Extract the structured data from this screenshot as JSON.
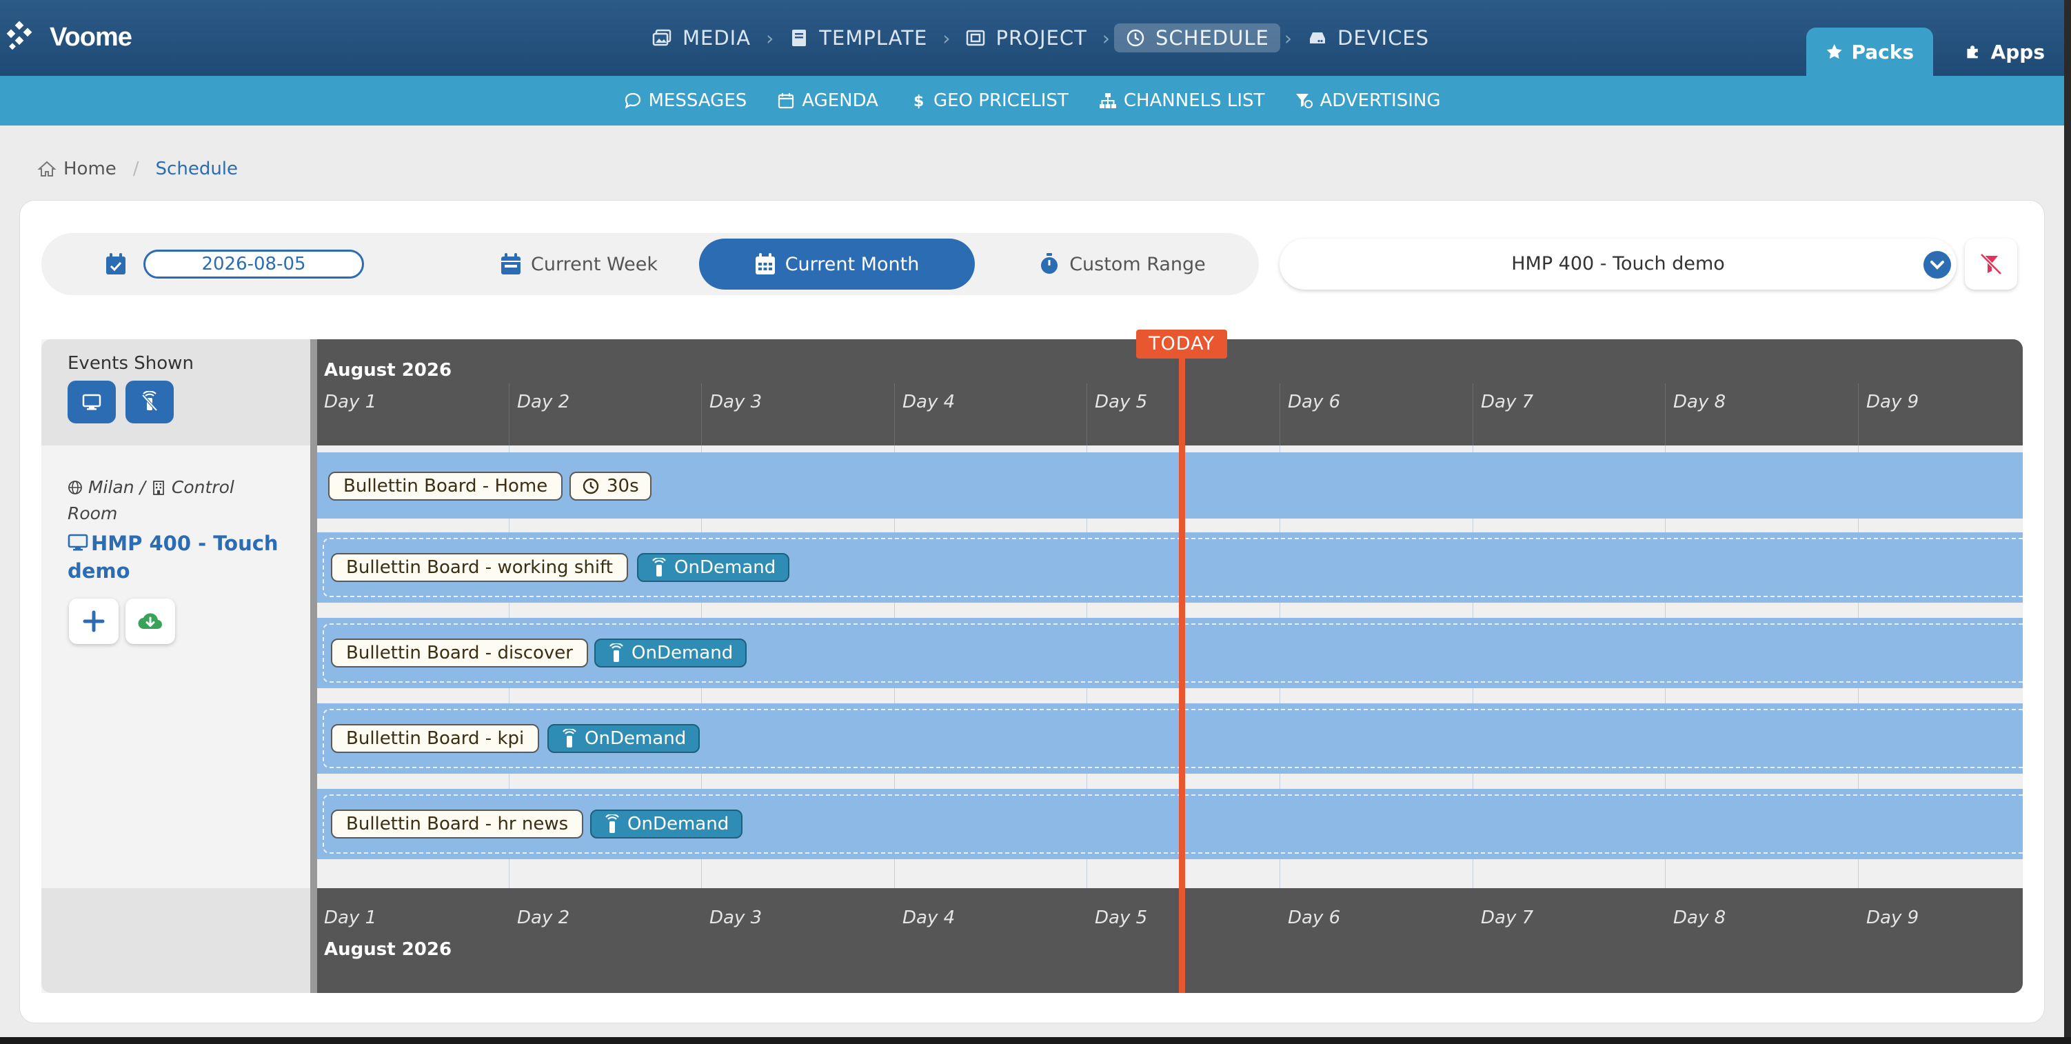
{
  "app": {
    "logo_text": "Voome"
  },
  "nav": {
    "steps": [
      {
        "label": "MEDIA",
        "icon": "images-icon"
      },
      {
        "label": "TEMPLATE",
        "icon": "book-icon"
      },
      {
        "label": "PROJECT",
        "icon": "project-icon"
      },
      {
        "label": "SCHEDULE",
        "icon": "clock-icon",
        "active": true
      },
      {
        "label": "DEVICES",
        "icon": "hdd-icon"
      }
    ],
    "packs_label": "Packs",
    "apps_label": "Apps"
  },
  "subnav": {
    "items": [
      {
        "label": "MESSAGES",
        "icon": "comment-icon"
      },
      {
        "label": "AGENDA",
        "icon": "calendar-icon"
      },
      {
        "label": "GEO PRICELIST",
        "icon": "dollar-icon"
      },
      {
        "label": "CHANNELS LIST",
        "icon": "sitemap-icon"
      },
      {
        "label": "ADVERTISING",
        "icon": "ad-filter-icon"
      }
    ]
  },
  "breadcrumb": {
    "home": "Home",
    "current": "Schedule"
  },
  "controls": {
    "date_value": "2026-08-05",
    "current_week": "Current Week",
    "current_month": "Current Month",
    "custom_range": "Custom Range",
    "device_selected": "HMP 400 - Touch demo"
  },
  "timeline": {
    "events_shown_label": "Events Shown",
    "month_label": "August 2026",
    "days": [
      "Day 1",
      "Day 2",
      "Day 3",
      "Day 4",
      "Day 5",
      "Day 6",
      "Day 7",
      "Day 8",
      "Day 9"
    ],
    "today_label": "TODAY",
    "location": {
      "city": "Milan",
      "separator": "/",
      "room": "Control Room"
    },
    "device_name": "HMP 400 - Touch demo",
    "events": [
      {
        "name": "Bullettin Board - Home",
        "tag": "30s",
        "tag_type": "duration"
      },
      {
        "name": "Bullettin Board - working shift",
        "tag": "OnDemand",
        "tag_type": "ondemand"
      },
      {
        "name": "Bullettin Board - discover",
        "tag": "OnDemand",
        "tag_type": "ondemand"
      },
      {
        "name": "Bullettin Board - kpi",
        "tag": "OnDemand",
        "tag_type": "ondemand"
      },
      {
        "name": "Bullettin Board - hr news",
        "tag": "OnDemand",
        "tag_type": "ondemand"
      }
    ]
  },
  "colors": {
    "nav_dark": "#1f4a76",
    "nav_light": "#3a9fc9",
    "accent_blue": "#2b6cb3",
    "lane_blue": "#8cb9e6",
    "today_orange": "#e8572f",
    "ondemand_teal": "#2f8db5"
  }
}
